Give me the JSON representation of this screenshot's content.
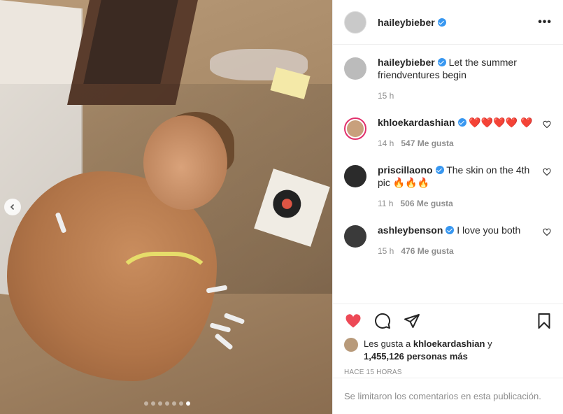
{
  "post": {
    "username": "haileybieber",
    "more_label": "•••",
    "carousel_dots": 7,
    "active_dot": 6
  },
  "caption": {
    "username": "haileybieber",
    "text": "Let the summer friendventures begin",
    "time": "15 h"
  },
  "comments": [
    {
      "username": "khloekardashian",
      "text": "❤️❤️❤️❤️ ❤️",
      "time": "14 h",
      "likes": "547 Me gusta"
    },
    {
      "username": "priscillaono",
      "text": "The skin on the 4th pic 🔥🔥🔥",
      "time": "11 h",
      "likes": "506 Me gusta"
    },
    {
      "username": "ashleybenson",
      "text": "I love you both",
      "time": "15 h",
      "likes": "476 Me gusta"
    }
  ],
  "likes": {
    "prefix": "Les gusta a",
    "user": "khloekardashian",
    "connector": "y",
    "count": "1,455,126 personas más"
  },
  "timestamp": "HACE 15 HORAS",
  "footer": "Se limitaron los comentarios en esta publicación.",
  "colors": {
    "like_red": "#ed4956",
    "verified_blue": "#3897f0",
    "meta_gray": "#8e8e8e"
  }
}
